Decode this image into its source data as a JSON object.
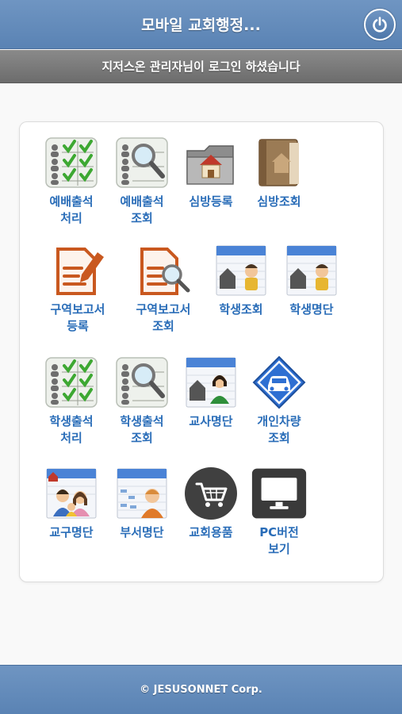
{
  "header": {
    "title": "모바일 교회행정..."
  },
  "subbar": {
    "text": "지저스온 관리자님이 로그인 하셨습니다"
  },
  "menu": [
    {
      "label": "예배출석\n처리",
      "icon": "attendance-check-icon"
    },
    {
      "label": "예배출석\n조회",
      "icon": "attendance-search-icon"
    },
    {
      "label": "심방등록",
      "icon": "folder-house-icon"
    },
    {
      "label": "심방조회",
      "icon": "book-house-icon"
    },
    {
      "label": "구역보고서\n등록",
      "icon": "document-pen-icon"
    },
    {
      "label": "구역보고서\n조회",
      "icon": "document-search-icon"
    },
    {
      "label": "학생조회",
      "icon": "student-card-icon"
    },
    {
      "label": "학생명단",
      "icon": "student-card-icon"
    },
    {
      "label": "학생출석\n처리",
      "icon": "attendance-check-icon"
    },
    {
      "label": "학생출석\n조회",
      "icon": "attendance-search-icon"
    },
    {
      "label": "교사명단",
      "icon": "teacher-card-icon"
    },
    {
      "label": "개인차량\n조회",
      "icon": "car-sign-icon"
    },
    {
      "label": "교구명단",
      "icon": "family-card-icon"
    },
    {
      "label": "부서명단",
      "icon": "department-card-icon"
    },
    {
      "label": "교회용품",
      "icon": "shopping-cart-icon"
    },
    {
      "label": "PC버전\n보기",
      "icon": "monitor-icon"
    }
  ],
  "footer": {
    "text": "© JESUSONNET Corp."
  },
  "colors": {
    "header": "#6286b6",
    "subbar": "#7a7a7a",
    "label": "#2a6db8"
  }
}
